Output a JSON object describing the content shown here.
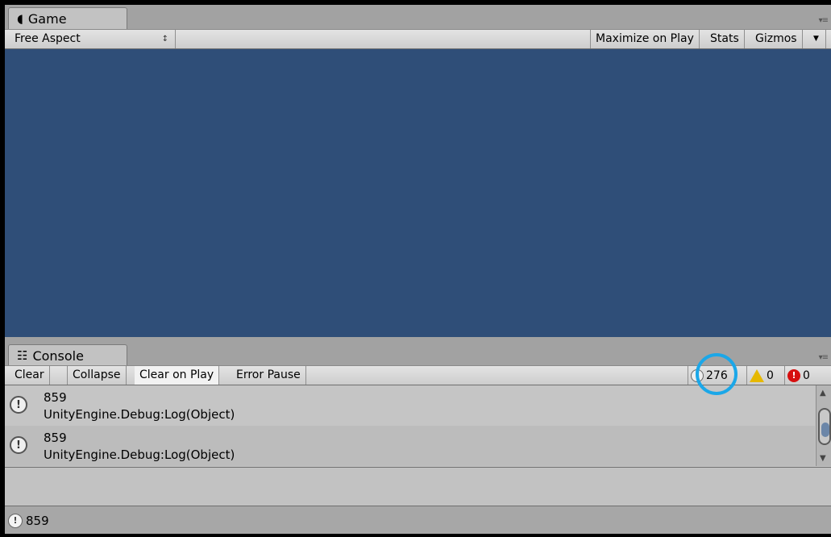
{
  "game": {
    "tab_label": "Game",
    "tab_icon": "pacman-icon",
    "aspect_label": "Free Aspect",
    "maximize_label": "Maximize on Play",
    "stats_label": "Stats",
    "gizmos_label": "Gizmos",
    "background_color": "#2f4e78"
  },
  "console": {
    "tab_label": "Console",
    "tab_icon": "console-icon",
    "toolbar": {
      "clear": "Clear",
      "collapse": "Collapse",
      "clear_on_play": "Clear on Play",
      "error_pause": "Error Pause"
    },
    "counts": {
      "log": "276",
      "warning": "0",
      "error": "0"
    },
    "entries": [
      {
        "line1": "859",
        "line2": "UnityEngine.Debug:Log(Object)"
      },
      {
        "line1": "859",
        "line2": "UnityEngine.Debug:Log(Object)"
      }
    ]
  },
  "status_bar": {
    "text": "859"
  },
  "colors": {
    "highlight": "#1ba7e8",
    "error": "#d60f0f",
    "warning": "#e6b800"
  }
}
